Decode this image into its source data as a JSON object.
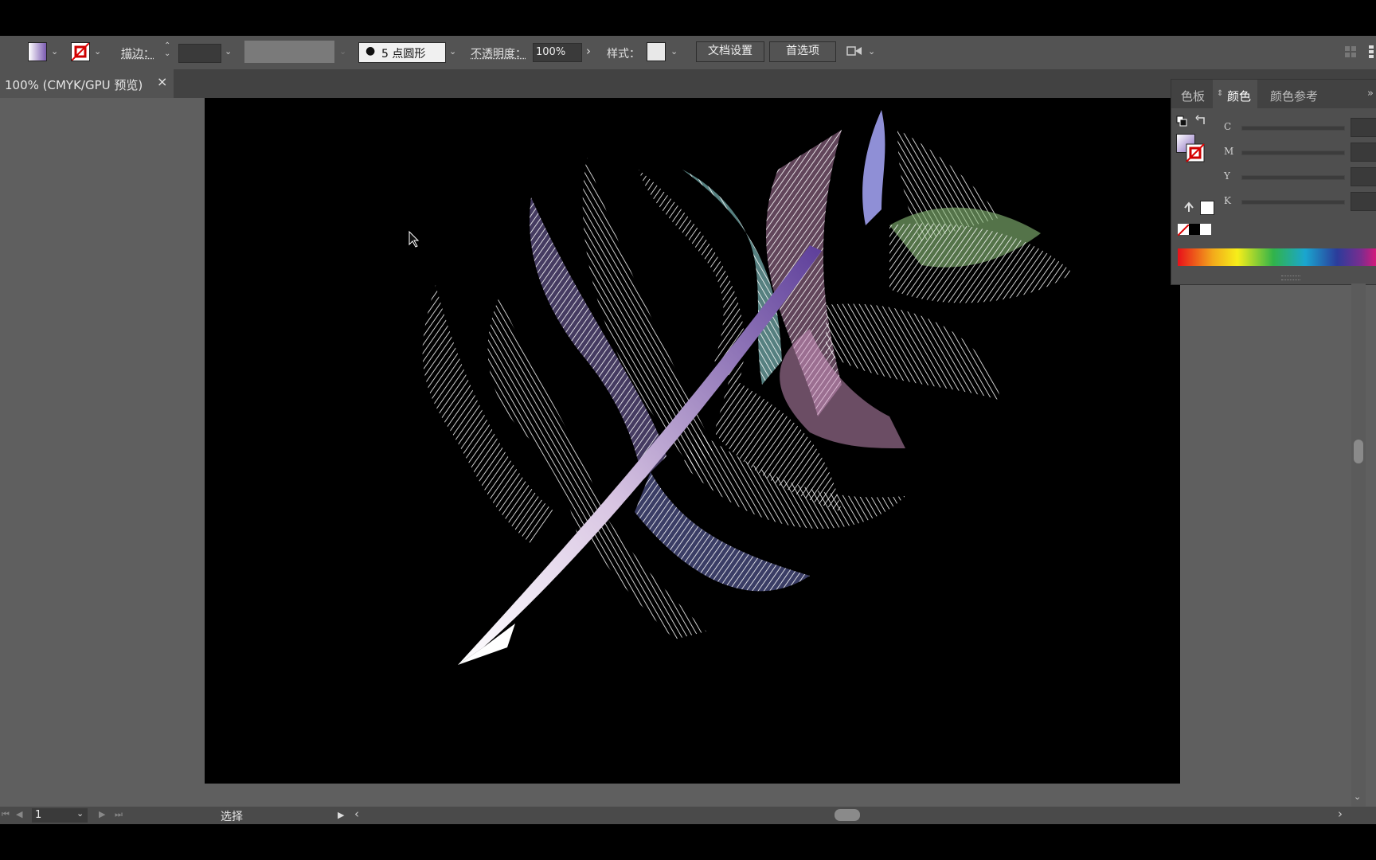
{
  "control_bar": {
    "stroke_label": "描边：",
    "brush_value": "5 点圆形",
    "opacity_label": "不透明度：",
    "opacity_value": "100%",
    "style_label": "样式：",
    "doc_setup_button": "文档设置",
    "preferences_button": "首选项"
  },
  "document_tab": {
    "title": "100% (CMYK/GPU 预览)",
    "close": "×"
  },
  "color_panel": {
    "tabs": [
      "色板",
      "颜色",
      "颜色参考"
    ],
    "active_tab": "颜色",
    "channels": [
      "C",
      "M",
      "Y",
      "K"
    ],
    "expand": "»"
  },
  "status_bar": {
    "artboard_number": "1",
    "tool_status": "选择"
  },
  "colors": {
    "artboard": "#000000",
    "ui_panel": "#535353",
    "accent_purple": "#9a86c4",
    "accent_teal": "#8fd6d6",
    "accent_green": "#8cc07a",
    "accent_pink": "#d69ac8"
  }
}
